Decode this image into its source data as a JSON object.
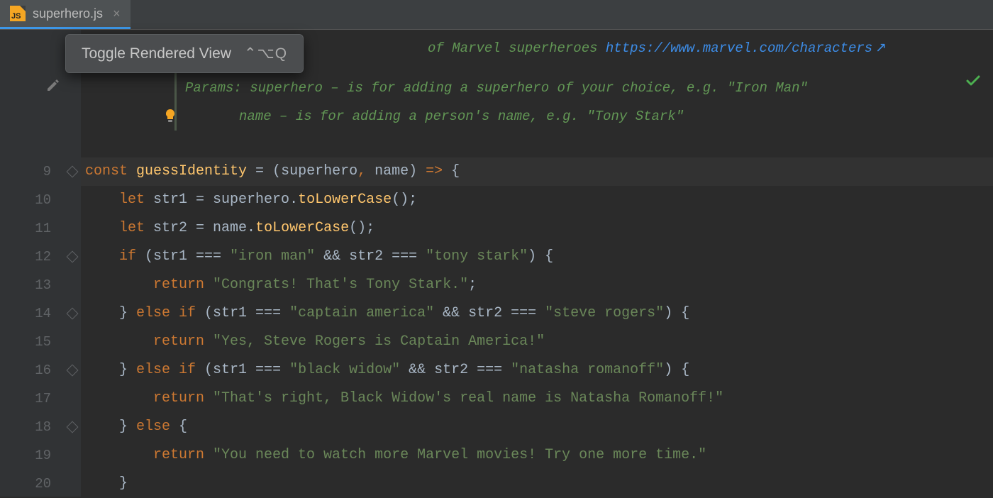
{
  "tab": {
    "filename": "superhero.js"
  },
  "tooltip": {
    "label": "Toggle Rendered View",
    "shortcut": "⌃⌥Q"
  },
  "jsdoc": {
    "line1_prefix": "... the ... of Marvel superheroes ",
    "link_text": "https://www.marvel.com/characters",
    "params_label": "Params:",
    "param1": " superhero – is for adding a superhero of your choice, e.g. \"Iron Man\"",
    "param2": "         name – is for adding a person's name, e.g. \"Tony Stark\""
  },
  "gutter": [
    "9",
    "10",
    "11",
    "12",
    "13",
    "14",
    "15",
    "16",
    "17",
    "18",
    "19",
    "20"
  ],
  "code": {
    "l9": {
      "kw1": "const ",
      "fn": "guessIdentity",
      "eq": " = (",
      "p1": "superhero",
      "c": ",",
      "p2": " name",
      "close": ") ",
      "arrow": "=>",
      "brace": " {"
    },
    "l10": {
      "indent": "    ",
      "kw": "let ",
      "var": "str1 = superhero.",
      "mth": "toLowerCase",
      "end": "();"
    },
    "l11": {
      "indent": "    ",
      "kw": "let ",
      "var": "str2 = name.",
      "mth": "toLowerCase",
      "end": "();"
    },
    "l12": {
      "indent": "    ",
      "kw": "if ",
      "open": "(str1 === ",
      "s1": "\"iron man\"",
      "mid": " && str2 === ",
      "s2": "\"tony stark\"",
      "close": ") {"
    },
    "l13": {
      "indent": "        ",
      "kw": "return ",
      "s": "\"Congrats! That's Tony Stark.\"",
      "semi": ";"
    },
    "l14": {
      "indent": "    ",
      "brace": "} ",
      "kw": "else if ",
      "open": "(str1 === ",
      "s1": "\"captain america\"",
      "mid": " && str2 === ",
      "s2": "\"steve rogers\"",
      "close": ") {"
    },
    "l15": {
      "indent": "        ",
      "kw": "return ",
      "s": "\"Yes, Steve Rogers is Captain America!\""
    },
    "l16": {
      "indent": "    ",
      "brace": "} ",
      "kw": "else if ",
      "open": "(str1 === ",
      "s1": "\"black widow\"",
      "mid": " && str2 === ",
      "s2": "\"natasha romanoff\"",
      "close": ") {"
    },
    "l17": {
      "indent": "        ",
      "kw": "return ",
      "s": "\"That's right, Black Widow's real name is Natasha Romanoff!\""
    },
    "l18": {
      "indent": "    ",
      "brace": "} ",
      "kw": "else ",
      "close": "{"
    },
    "l19": {
      "indent": "        ",
      "kw": "return ",
      "s": "\"You need to watch more Marvel movies! Try one more time.\""
    },
    "l20": {
      "indent": "    ",
      "brace": "}"
    }
  }
}
